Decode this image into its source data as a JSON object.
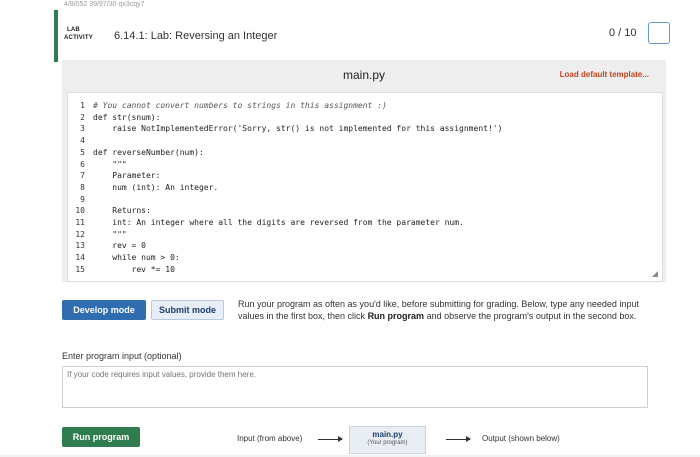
{
  "top_strip": {
    "text": "4/8/052 39/97/30 qx3cqy7"
  },
  "header": {
    "lab_badge_line1": "LAB",
    "lab_badge_line2": "ACTIVITY",
    "title": "6.14.1: Lab: Reversing an Integer",
    "score": "0 / 10"
  },
  "editor": {
    "file_name": "main.py",
    "load_template": "Load default template...",
    "lines": [
      {
        "n": "1",
        "code": "# You cannot convert numbers to strings in this assignment :)"
      },
      {
        "n": "2",
        "code": "def str(snum):"
      },
      {
        "n": "3",
        "code": "    raise NotImplementedError('Sorry, str() is not implemented for this assignment!')"
      },
      {
        "n": "4",
        "code": ""
      },
      {
        "n": "5",
        "code": "def reverseNumber(num):"
      },
      {
        "n": "6",
        "code": "    \"\"\""
      },
      {
        "n": "7",
        "code": "    Parameter:"
      },
      {
        "n": "8",
        "code": "    num (int): An integer."
      },
      {
        "n": "9",
        "code": ""
      },
      {
        "n": "10",
        "code": "    Returns:"
      },
      {
        "n": "11",
        "code": "    int: An integer where all the digits are reversed from the parameter num."
      },
      {
        "n": "12",
        "code": "    \"\"\""
      },
      {
        "n": "13",
        "code": "    rev = 0"
      },
      {
        "n": "14",
        "code": "    while num > 0:"
      },
      {
        "n": "15",
        "code": "        rev *= 10"
      }
    ]
  },
  "actions": {
    "develop_mode": "Develop mode",
    "submit_mode": "Submit mode",
    "desc_part1": "Run your program as often as you'd like, before submitting for grading. Below, type any needed input values in the first box, then click ",
    "desc_bold": "Run program",
    "desc_part2": " and observe the program's output in the second box."
  },
  "input": {
    "label": "Enter program input (optional)",
    "placeholder": "If your code requires input values, provide them here."
  },
  "run": {
    "button": "Run program",
    "input_from": "Input (from above)",
    "program_name": "main.py",
    "program_sub": "(Your program)",
    "output": "Output (shown below)"
  }
}
